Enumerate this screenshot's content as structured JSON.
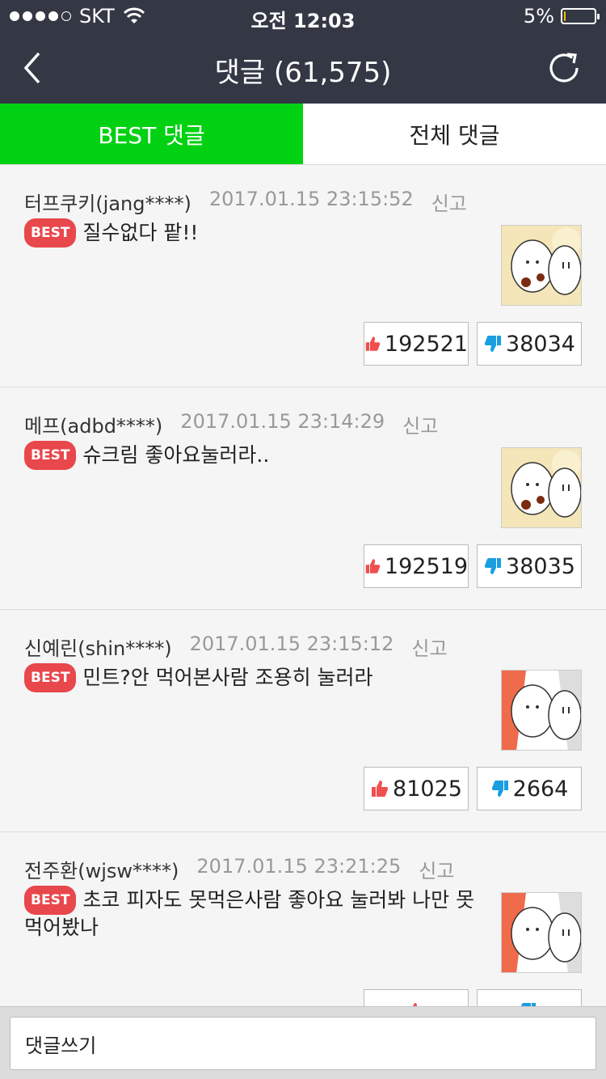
{
  "status_bar": {
    "carrier": "SKT",
    "time": "오전 12:03",
    "battery": "5%",
    "battery_level": 0.05
  },
  "header": {
    "title": "댓글 (61,575)"
  },
  "tabs": [
    {
      "label": "BEST 댓글"
    },
    {
      "label": "전체 댓글"
    }
  ],
  "badge_label": "BEST",
  "comments": [
    {
      "user": "터프쿠키(jang****)",
      "date": "2017.01.15 23:15:52",
      "report": "신고",
      "text": "질수없다 팥!!",
      "likes": "192521",
      "dislikes": "38034"
    },
    {
      "user": "메프(adbd****)",
      "date": "2017.01.15 23:14:29",
      "report": "신고",
      "text": "슈크림 좋아요눌러라..",
      "likes": "192519",
      "dislikes": "38035"
    },
    {
      "user": "신예린(shin****)",
      "date": "2017.01.15 23:15:12",
      "report": "신고",
      "text": "민트?안 먹어본사람 조용히 눌러라",
      "likes": "81025",
      "dislikes": "2664"
    },
    {
      "user": "전주환(wjsw****)",
      "date": "2017.01.15 23:21:25",
      "report": "신고",
      "text": "초코 피자도 못먹은사람 좋아요 눌러봐 나만 못 먹어봤나",
      "likes": "",
      "dislikes": ""
    }
  ],
  "composer": {
    "placeholder": "댓글쓰기"
  },
  "colors": {
    "header_bg": "#343845",
    "tab_active": "#00d112",
    "badge": "#e8474c",
    "like_icon": "#f04f4f",
    "dislike_icon": "#1a9ee0"
  }
}
